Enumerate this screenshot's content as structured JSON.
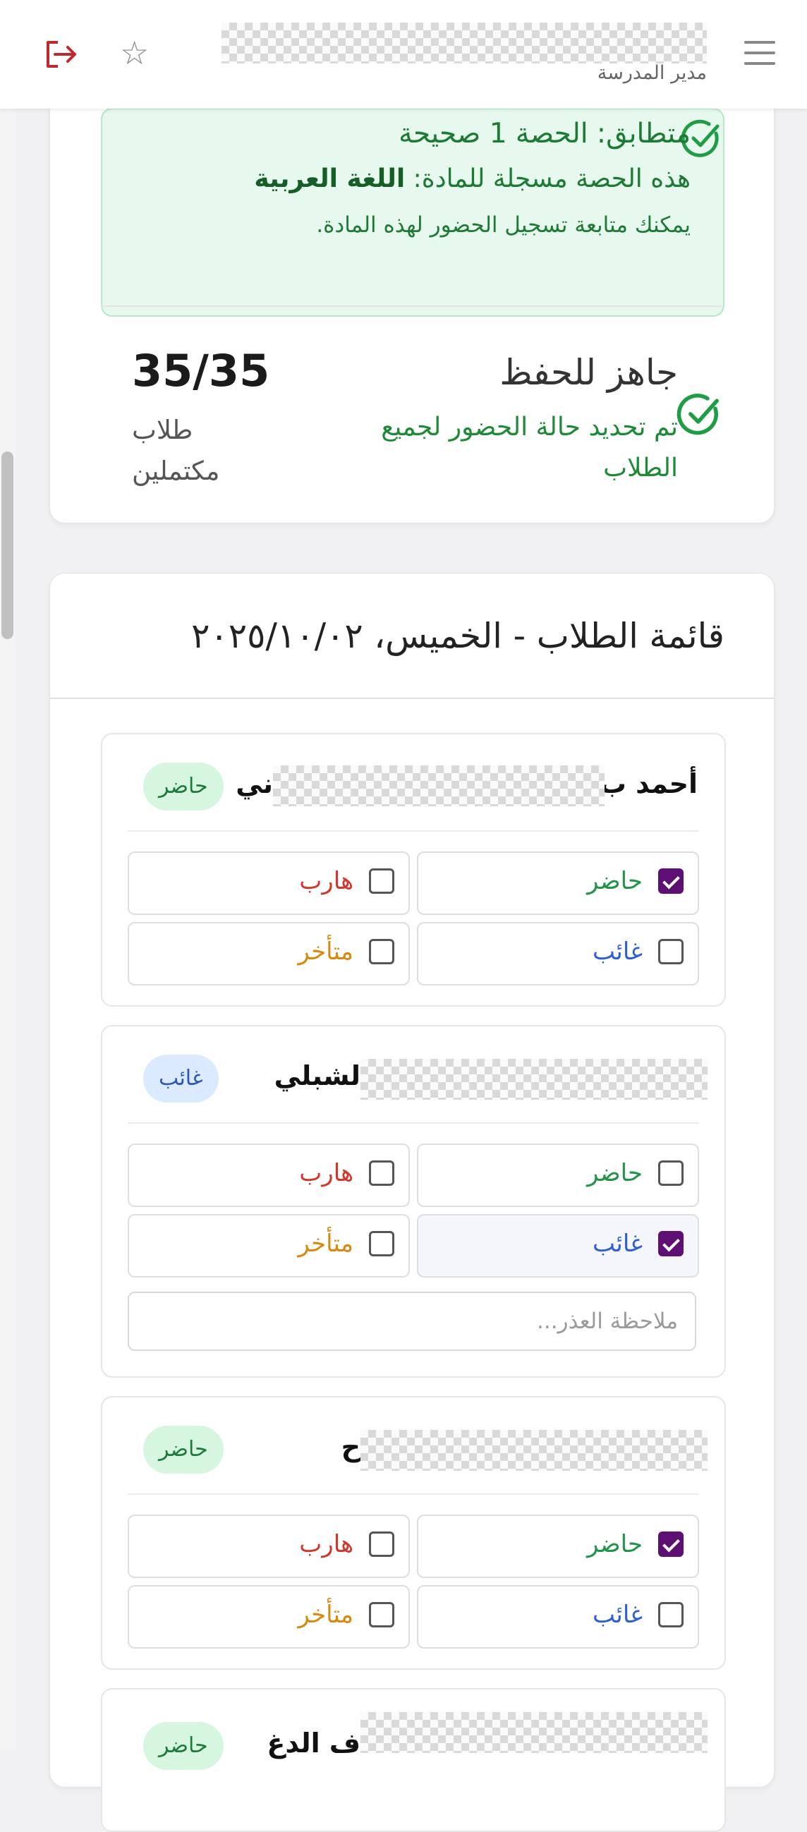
{
  "header": {
    "role": "مدير المدرسة",
    "icons": [
      "menu-icon",
      "star-icon",
      "logout-icon"
    ]
  },
  "summary": {
    "match_title": "متطابق: الحصة 1 صحيحة",
    "subject_prefix": "هذه الحصة مسجلة للمادة:",
    "subject_name": "اللغة العربية",
    "continue_text": "يمكنك متابعة تسجيل الحضور لهذه المادة.",
    "ready_title": "جاهز للحفظ",
    "ready_desc": "تم تحديد حالة الحضور لجميع الطلاب",
    "count": "35/35",
    "count_label": "طلاب مكتملين"
  },
  "list": {
    "title": "قائمة الطلاب - الخميس، ٢٠٢٥/١٠/٠٢",
    "options": {
      "present": "حاضر",
      "absent": "غائب",
      "escaped": "هارب",
      "late": "متأخر"
    },
    "note_placeholder": "ملاحظة العذر...",
    "students": [
      {
        "name_start": "أحمد ب",
        "name_end": "ني",
        "status": "حاضر",
        "checked": "present"
      },
      {
        "name_start": "",
        "name_end": "لشبلي",
        "status": "غائب",
        "checked": "absent"
      },
      {
        "name_start": "",
        "name_end": "ح",
        "status": "حاضر",
        "checked": "present"
      },
      {
        "name_start": "",
        "name_end": "ف الدغ",
        "status": "حاضر",
        "checked": ""
      }
    ]
  },
  "colors": {
    "accent": "#5e0f73",
    "present": "#22944a",
    "absent": "#2f5fd0",
    "escaped": "#d0382b",
    "late": "#d68a10",
    "success_bg": "#e7f8ee"
  }
}
